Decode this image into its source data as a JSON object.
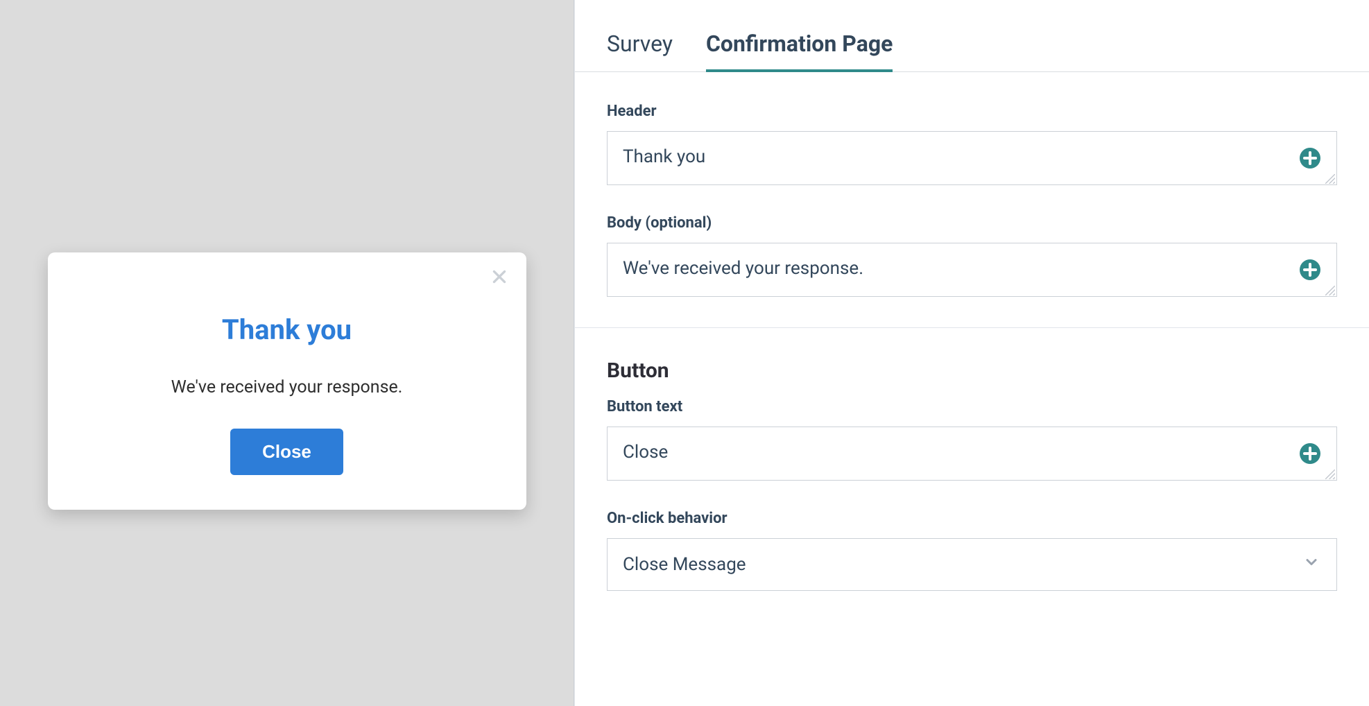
{
  "preview": {
    "title": "Thank you",
    "body": "We've received your response.",
    "button_label": "Close"
  },
  "editor": {
    "tabs": [
      {
        "label": "Survey",
        "active": false
      },
      {
        "label": "Confirmation Page",
        "active": true
      }
    ],
    "header_field": {
      "label": "Header",
      "value": "Thank you"
    },
    "body_field": {
      "label": "Body (optional)",
      "value": "We've received your response."
    },
    "button_section": {
      "title": "Button",
      "text_field": {
        "label": "Button text",
        "value": "Close"
      },
      "onclick_field": {
        "label": "On-click behavior",
        "selected": "Close Message"
      }
    }
  }
}
